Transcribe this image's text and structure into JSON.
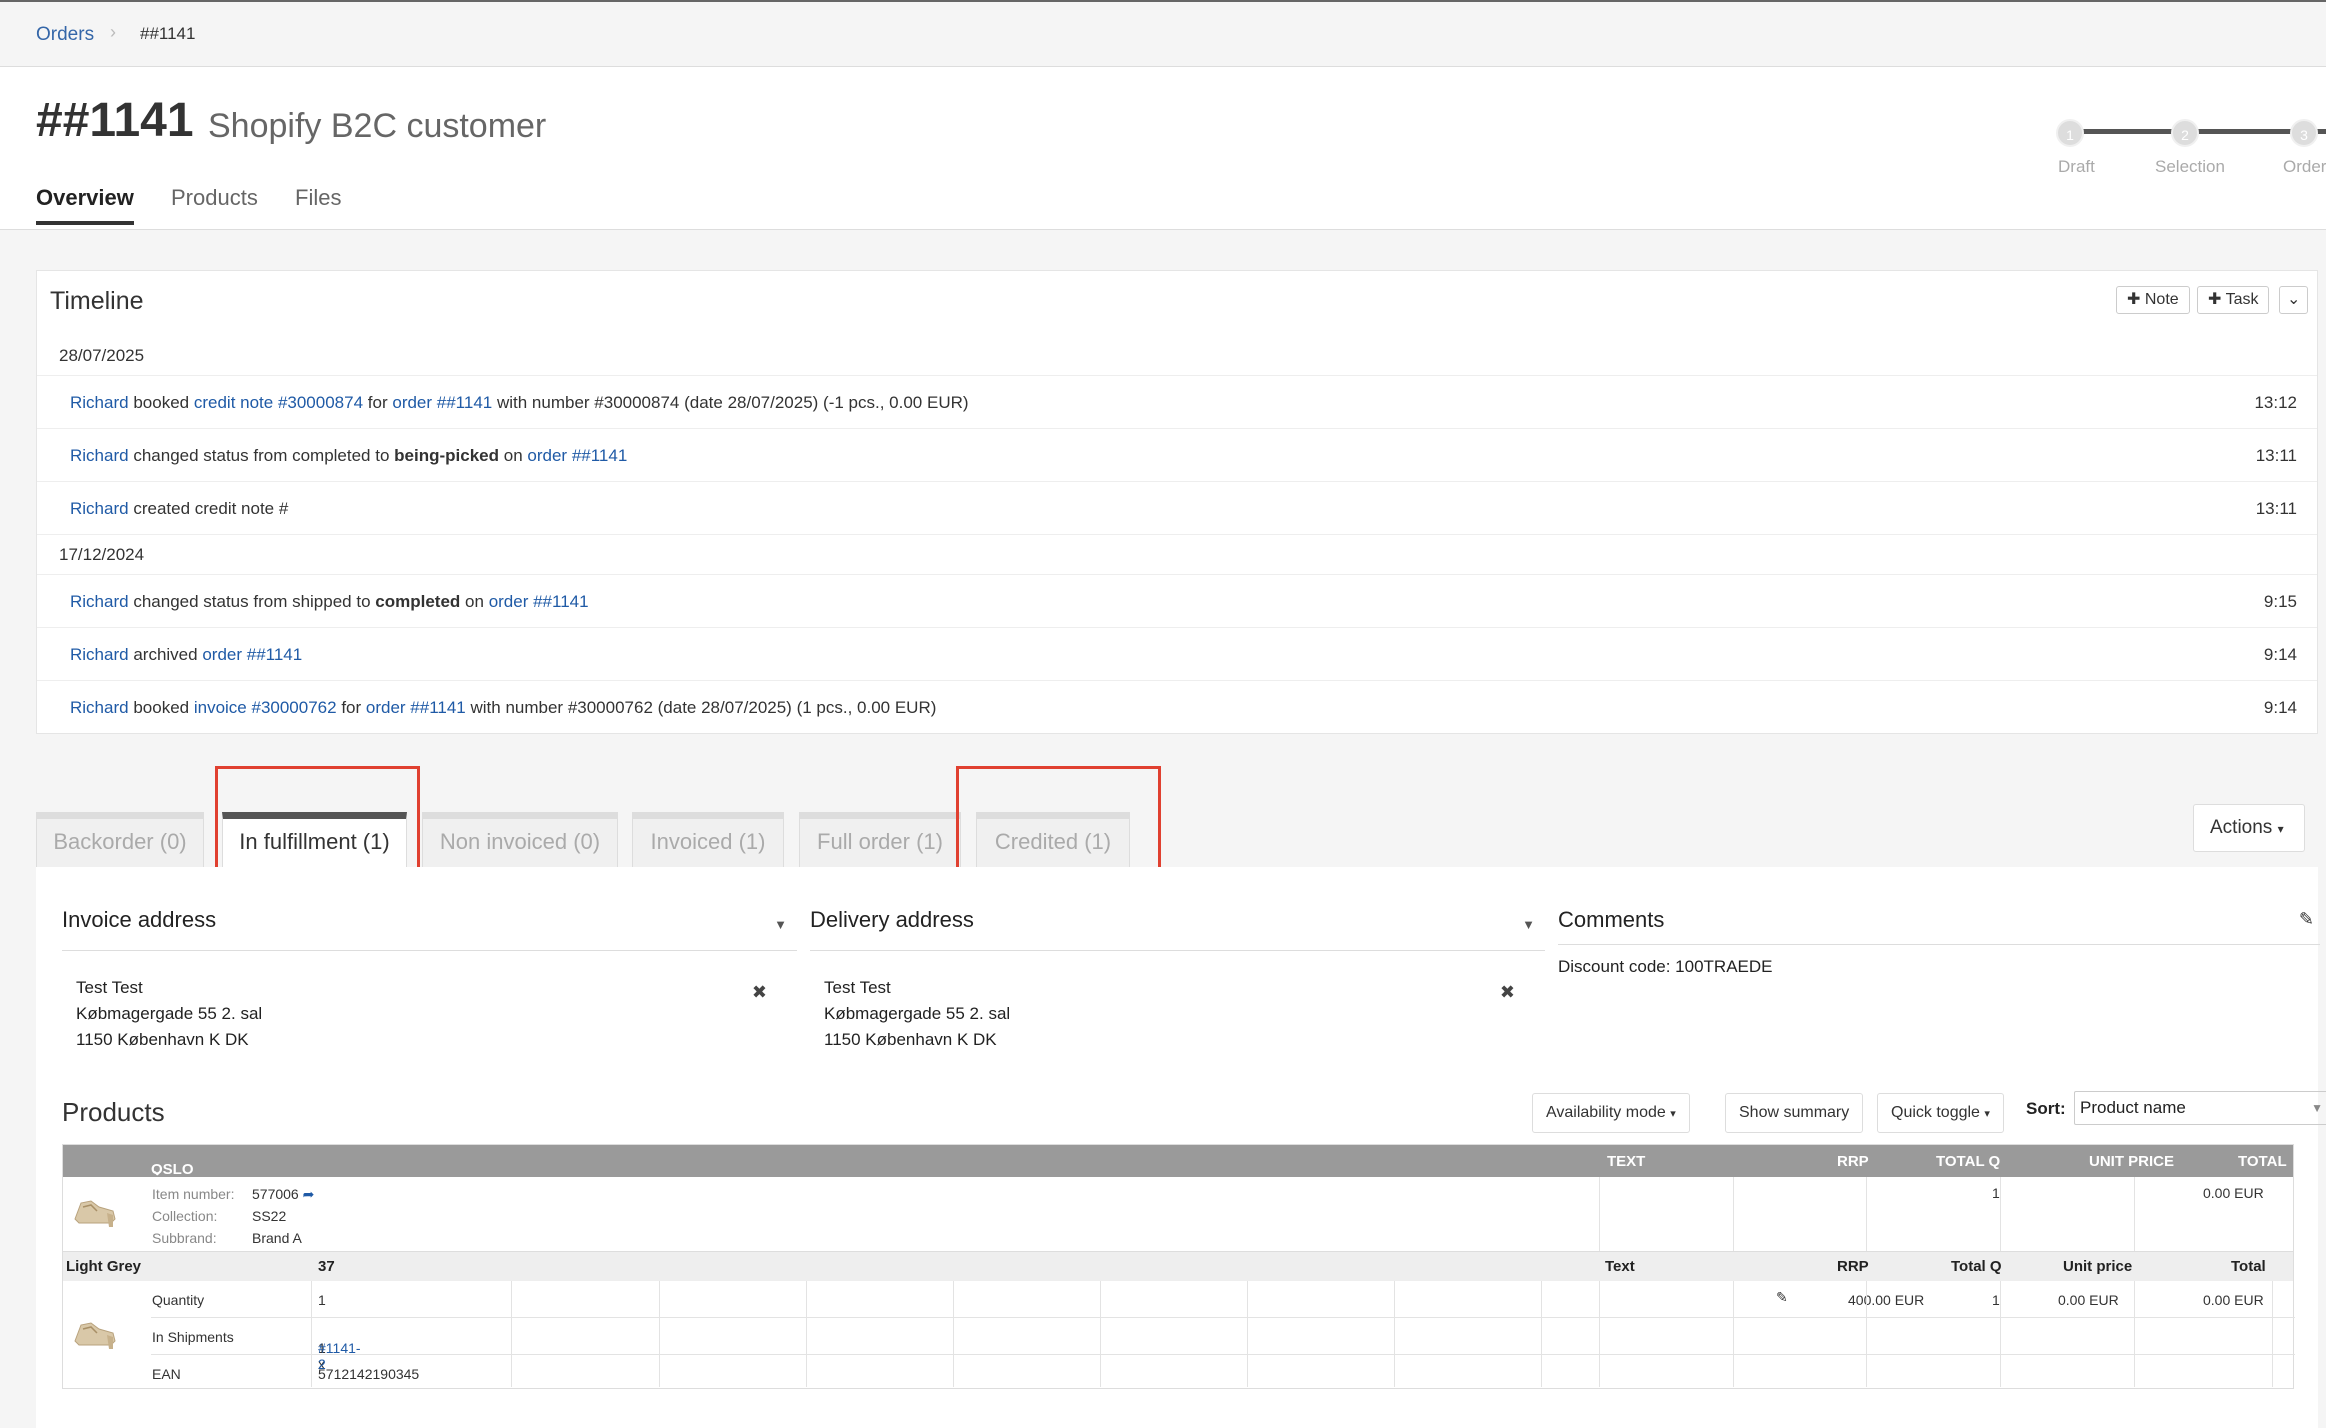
{
  "breadcrumb": {
    "root": "Orders",
    "current": "##1141"
  },
  "header": {
    "order_number": "##1141",
    "customer": "Shopify B2C customer",
    "tabs": [
      "Overview",
      "Products",
      "Files"
    ],
    "steps": [
      {
        "num": "1",
        "label": "Draft"
      },
      {
        "num": "2",
        "label": "Selection"
      },
      {
        "num": "3",
        "label": "Order"
      }
    ]
  },
  "timeline": {
    "title": "Timeline",
    "note_btn": "Note",
    "task_btn": "Task",
    "groups": [
      {
        "date": "28/07/2025",
        "entries": [
          {
            "user": "Richard",
            "t1": "booked",
            "l1": "credit note #30000874",
            "t2": "for",
            "l2": "order ##1141",
            "t3": "with number #30000874 (date 28/07/2025) (-1 pcs., 0.00 EUR)",
            "time": "13:12"
          },
          {
            "user": "Richard",
            "t1": "changed status from completed to",
            "bold": "being-picked",
            "t2": "on",
            "l2": "order ##1141",
            "time": "13:11"
          },
          {
            "user": "Richard",
            "t1": "created credit note #",
            "time": "13:11"
          }
        ]
      },
      {
        "date": "17/12/2024",
        "entries": [
          {
            "user": "Richard",
            "t1": "changed status from shipped to",
            "bold": "completed",
            "t2": "on",
            "l2": "order ##1141",
            "time": "9:15"
          },
          {
            "user": "Richard",
            "t1": "archived",
            "l2": "order ##1141",
            "time": "9:14"
          },
          {
            "user": "Richard",
            "t1": "booked",
            "l1": "invoice #30000762",
            "t2": "for",
            "l2": "order ##1141",
            "t3": "with number #30000762 (date 28/07/2025) (1 pcs., 0.00 EUR)",
            "time": "9:14"
          }
        ]
      }
    ]
  },
  "order_tabs": [
    "Backorder (0)",
    "In fulfillment (1)",
    "Non invoiced (0)",
    "Invoiced (1)",
    "Full order (1)",
    "Credited (1)"
  ],
  "actions_label": "Actions",
  "invoice_address": {
    "title": "Invoice address",
    "lines": [
      "Test Test",
      "Købmagergade 55 2. sal",
      "1150 København K DK"
    ]
  },
  "delivery_address": {
    "title": "Delivery address",
    "lines": [
      "Test Test",
      "Købmagergade 55 2. sal",
      "1150 København K DK"
    ]
  },
  "comments": {
    "title": "Comments",
    "text": "Discount code: 100TRAEDE"
  },
  "products": {
    "title": "Products",
    "availability_btn": "Availability mode",
    "summary_btn": "Show summary",
    "quick_toggle_btn": "Quick toggle",
    "sort_label": "Sort:",
    "sort_value": "Product name",
    "group_name": "OSLO",
    "header_cols": {
      "text": "TEXT",
      "rrp": "RRP",
      "total_q": "TOTAL Q",
      "unit_price": "UNIT PRICE",
      "total": "TOTAL"
    },
    "item": {
      "item_number_label": "Item number:",
      "item_number": "577006",
      "collection_label": "Collection:",
      "collection": "SS22",
      "subbrand_label": "Subbrand:",
      "subbrand": "Brand A",
      "total_q": "1",
      "total": "0.00 EUR"
    },
    "variant": {
      "color": "Light Grey",
      "size": "37",
      "cols": {
        "text": "Text",
        "rrp": "RRP",
        "total_q": "Total Q",
        "unit_price": "Unit price",
        "total": "Total"
      },
      "quantity_label": "Quantity",
      "quantity": "1",
      "rrp": "400.00 EUR",
      "total_q": "1",
      "unit_price": "0.00 EUR",
      "total": "0.00 EUR",
      "shipments_label": "In Shipments",
      "shipments_prefix": "1 x",
      "shipments_link": "#1141-2",
      "ean_label": "EAN",
      "ean": "5712142190345"
    }
  },
  "colors": {
    "link": "#1f5aa6",
    "highlight": "#e04030",
    "table_header": "#9a9a9a"
  }
}
